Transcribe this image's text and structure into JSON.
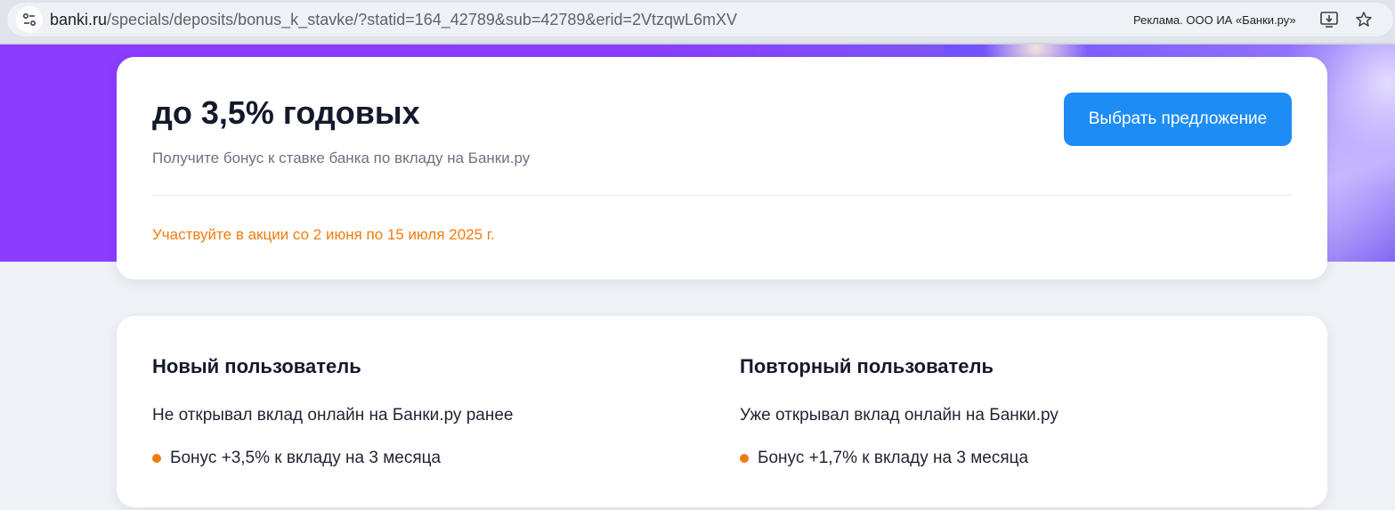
{
  "browser": {
    "url_host": "banki.ru",
    "url_path": "/specials/deposits/bonus_k_stavke/?statid=164_42789&sub=42789&erid=2VtzqwL6mXV",
    "ad_label": "Реклама. ООО ИА «Банки.ру»",
    "icons": [
      "site-info-icon",
      "install-app-icon",
      "bookmark-star-icon"
    ]
  },
  "hero": {
    "headline": "до 3,5% годовых",
    "subline": "Получите бонус к ставке банка по вкладу на Банки.ру",
    "cta_label": "Выбрать предложение",
    "promo_period": "Участвуйте в акции со 2 июня по 15 июля 2025 г."
  },
  "users": {
    "new": {
      "title": "Новый пользователь",
      "description": "Не открывал вклад онлайн на Банки.ру ранее",
      "bonus": "Бонус +3,5% к вкладу на 3 месяца"
    },
    "returning": {
      "title": "Повторный пользователь",
      "description": "Уже открывал вклад онлайн на Банки.ру",
      "bonus": "Бонус +1,7% к вкладу на 3 месяца"
    }
  },
  "colors": {
    "accent_blue": "#1d8cf5",
    "accent_orange": "#f07c0e",
    "hero_purple": "#8b3cff"
  }
}
